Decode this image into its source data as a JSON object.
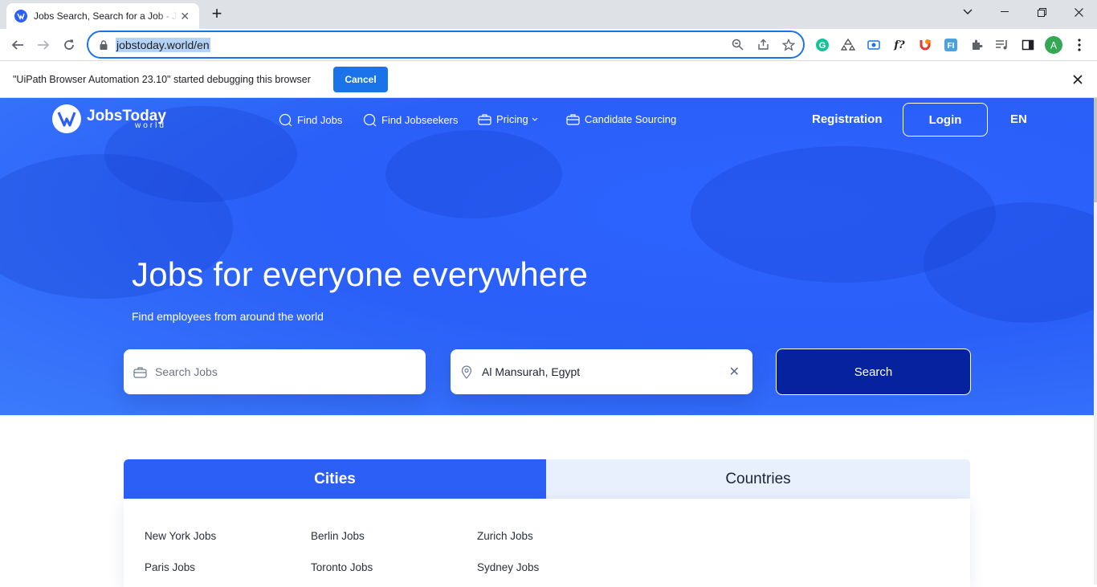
{
  "browser": {
    "tab_title": "Jobs Search, Search for a Job - Jobs Today",
    "url": "jobstoday.world/en",
    "new_tab": "+",
    "extensions": [
      "grammarly-icon",
      "recycle-icon",
      "screen-record-icon",
      "f?",
      "puzzle-icon"
    ],
    "ext_text_f": "f?",
    "profile_initial": "A"
  },
  "infobar": {
    "message": "\"UiPath Browser Automation 23.10\" started debugging this browser",
    "cancel_label": "Cancel"
  },
  "site": {
    "logo_name": "JobsToday",
    "logo_sub": "world",
    "nav": {
      "find_jobs": "Find Jobs",
      "find_jobseekers": "Find Jobseekers",
      "pricing": "Pricing",
      "candidate_sourcing": "Candidate Sourcing"
    },
    "registration": "Registration",
    "login": "Login",
    "language": "EN"
  },
  "hero": {
    "headline": "Jobs for everyone everywhere",
    "subline": "Find employees from around the world",
    "search_placeholder": "Search Jobs",
    "location_value": "Al Mansurah, Egypt",
    "search_button": "Search"
  },
  "locations": {
    "tabs": {
      "cities": "Cities",
      "countries": "Countries"
    },
    "cities": [
      "New York Jobs",
      "Berlin Jobs",
      "Zurich Jobs",
      "Paris Jobs",
      "Toronto Jobs",
      "Sydney Jobs"
    ]
  },
  "colors": {
    "brand_blue": "#2b5ff5",
    "search_button": "#06229e",
    "tab_inactive": "#e9f0fd",
    "chrome_accent": "#1a73e8"
  }
}
